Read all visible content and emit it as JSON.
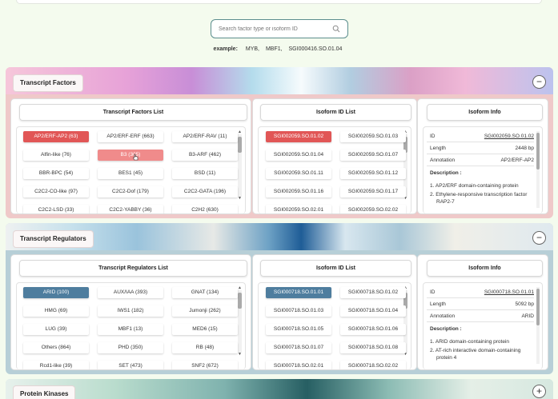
{
  "search": {
    "placeholder": "Search factor type or isoform ID"
  },
  "example": {
    "label": "example:",
    "items": [
      "MYB,",
      "MBF1,",
      "SGI000416.SO.01.04"
    ]
  },
  "sections": {
    "tf": {
      "title": "Transcript Factors",
      "toggle": "−",
      "list_title": "Transcript Factors List",
      "factors": [
        "AP2/ERF-AP2 (63)",
        "AP2/ERF-ERF (663)",
        "AP2/ERF-RAV (11)",
        "Alfin-like (76)",
        "B3 (305)",
        "B3-ARF (462)",
        "BBR-BPC (54)",
        "BES1 (45)",
        "BSD (11)",
        "C2C2-CO-like (97)",
        "C2C2-Dof (179)",
        "C2C2-GATA (196)",
        "C2C2-LSD (33)",
        "C2C2-YABBY (36)",
        "C2H2 (630)"
      ],
      "isoform_title": "Isoform ID List",
      "isoforms": [
        "SGI002059.SO.01.02",
        "SGI002059.SO.01.03",
        "SGI002059.SO.01.04",
        "SGI002059.SO.01.07",
        "SGI002059.SO.01.11",
        "SGI002059.SO.01.12",
        "SGI002059.SO.01.16",
        "SGI002059.SO.01.17",
        "SGI002059.SO.02.01",
        "SGI002059.SO.02.02"
      ],
      "info_title": "Isoform Info",
      "info": {
        "id_label": "ID",
        "id_value": "SGI002059.SO.01.02",
        "length_label": "Length",
        "length_value": "2448 bp",
        "annotation_label": "Annotation",
        "annotation_value": "AP2/ERF-AP2",
        "description_label": "Description :",
        "descriptions": [
          "1. AP2/ERF domain-containing protein",
          "2. Ethylene-responsive transcription factor RAP2-7"
        ]
      }
    },
    "tr": {
      "title": "Transcript Regulators",
      "toggle": "−",
      "list_title": "Transcript Regulators List",
      "factors": [
        "ARID (100)",
        "AUX/IAA (393)",
        "GNAT (134)",
        "HMG (69)",
        "IWS1 (182)",
        "Jumonji (262)",
        "LUG (39)",
        "MBF1 (13)",
        "MED6 (15)",
        "Others (864)",
        "PHD (350)",
        "RB (48)",
        "Rcd1-like (39)",
        "SET (473)",
        "SNF2 (672)"
      ],
      "isoform_title": "Isoform ID List",
      "isoforms": [
        "SGI000718.SO.01.01",
        "SGI000718.SO.01.02",
        "SGI000718.SO.01.03",
        "SGI000718.SO.01.04",
        "SGI000718.SO.01.05",
        "SGI000718.SO.01.06",
        "SGI000718.SO.01.07",
        "SGI000718.SO.01.08",
        "SGI000718.SO.02.01",
        "SGI000718.SO.02.02"
      ],
      "info_title": "Isoform Info",
      "info": {
        "id_label": "ID",
        "id_value": "SGI000718.SO.01.01",
        "length_label": "Length",
        "length_value": "5092 bp",
        "annotation_label": "Annotation",
        "annotation_value": "ARID",
        "description_label": "Description :",
        "descriptions": [
          "1. ARID domain-containing protein",
          "2. AT-rich interactive domain-containing protein 4"
        ]
      }
    },
    "pk": {
      "title": "Protein Kinases",
      "toggle": "+"
    }
  },
  "colors": {
    "selected_red": "#e15656",
    "hover_red": "#f08b8b",
    "selected_blue": "#4e7d9e"
  },
  "icons": {
    "search": "search-icon",
    "scroll_up": "scroll-up-arrow-icon",
    "scroll_down": "scroll-down-arrow-icon",
    "cursor": "hand-pointer-cursor-icon"
  }
}
